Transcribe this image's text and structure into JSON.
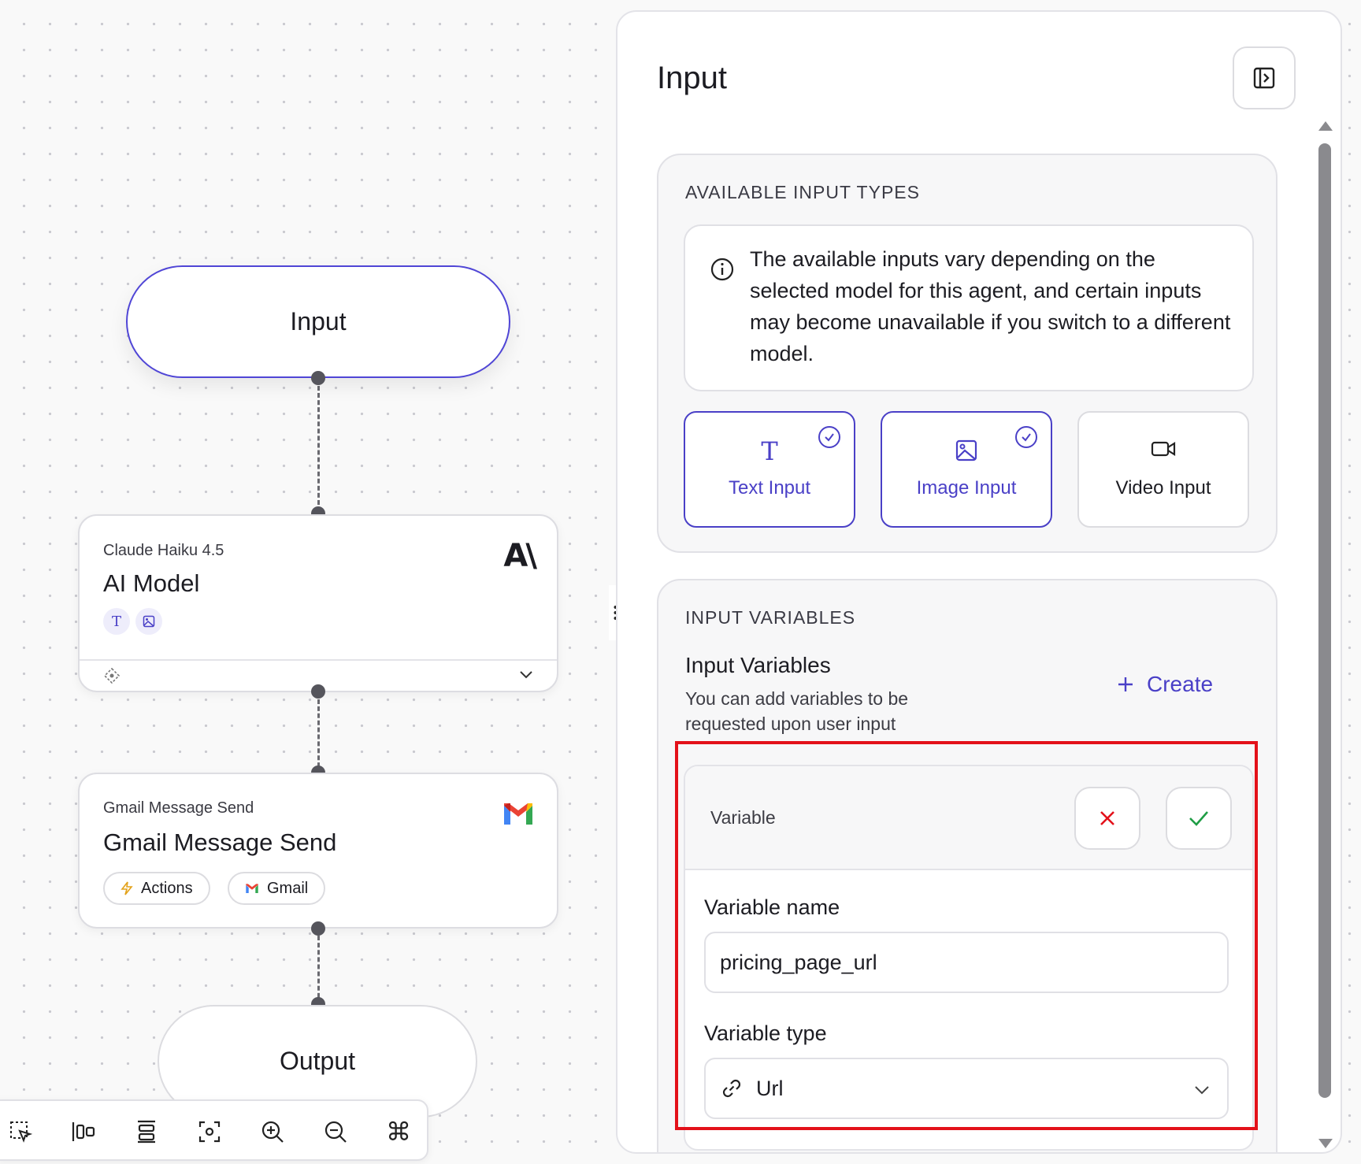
{
  "canvas": {
    "nodes": {
      "input_label": "Input",
      "output_label": "Output",
      "ai_model": {
        "subtitle": "Claude Haiku 4.5",
        "title": "AI Model",
        "logo_text": "A\\"
      },
      "gmail": {
        "subtitle": "Gmail Message Send",
        "title": "Gmail Message Send",
        "chips": [
          "Actions",
          "Gmail"
        ]
      }
    },
    "toolbar_icons": [
      "selection-icon",
      "align-icon",
      "distribute-icon",
      "fit-view-icon",
      "zoom-in-icon",
      "zoom-out-icon",
      "shortcut-icon"
    ]
  },
  "panel": {
    "title": "Input",
    "available_types": {
      "header": "AVAILABLE INPUT TYPES",
      "info": "The available inputs vary depending on the selected model for this agent, and certain inputs may become unavailable if you switch to a different model.",
      "types": [
        {
          "label": "Text Input",
          "selected": true
        },
        {
          "label": "Image Input",
          "selected": true
        },
        {
          "label": "Video Input",
          "selected": false
        }
      ]
    },
    "input_variables": {
      "header": "INPUT VARIABLES",
      "title": "Input Variables",
      "description": "You can add variables to be requested upon user input",
      "create_label": "Create",
      "form": {
        "head_label": "Variable",
        "name_label": "Variable name",
        "name_value": "pricing_page_url",
        "type_label": "Variable type",
        "type_value": "Url"
      }
    }
  },
  "colors": {
    "accent": "#4a40c7",
    "cancel": "#e3111a",
    "confirm": "#1f9d45",
    "highlight": "#e3111a"
  }
}
